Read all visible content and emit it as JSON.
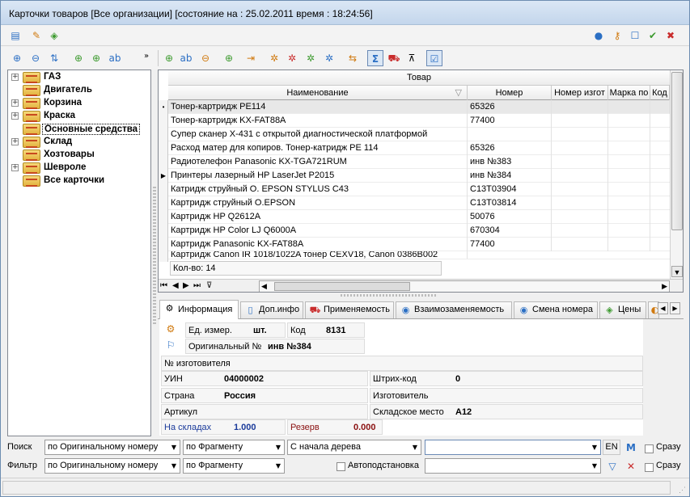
{
  "window": {
    "title": "Карточки товаров  [Все организации] [состояние на : 25.02.2011  время : 18:24:56]"
  },
  "toolbar_top": {
    "left_icons": [
      "report-icon",
      "edit-icon",
      "tag-icon"
    ],
    "right_icons": [
      "help-icon",
      "key-icon",
      "maximize-icon",
      "ok-icon",
      "close-icon"
    ]
  },
  "toolbar_tree": {
    "icons": [
      "zoom-in-icon",
      "zoom-out-icon",
      "sort-az-icon",
      "add-icon",
      "add-copy-icon",
      "rename-icon",
      "more-icon"
    ]
  },
  "toolbar_grid": {
    "icons": [
      "add-icon",
      "edit-icon",
      "delete-icon",
      "add-copy-icon",
      "move-icon",
      "settings-icon",
      "settings-remove-icon",
      "settings-green-icon",
      "settings-blue-icon",
      "group-icon",
      "sum-icon",
      "truck-icon",
      "clear-filter-icon",
      "checklist-icon"
    ]
  },
  "tree": [
    {
      "label": "ГАЗ",
      "expandable": true
    },
    {
      "label": "Двигатель",
      "expandable": false
    },
    {
      "label": "Корзина",
      "expandable": true
    },
    {
      "label": "Краска",
      "expandable": true
    },
    {
      "label": "Основные средства",
      "expandable": false,
      "selected": true
    },
    {
      "label": "Склад",
      "expandable": true
    },
    {
      "label": "Хозтовары",
      "expandable": false
    },
    {
      "label": "Шевроле",
      "expandable": true
    },
    {
      "label": "Все карточки",
      "expandable": false
    }
  ],
  "grid": {
    "group_header": "Товар",
    "columns": [
      "Наименование",
      "Номер",
      "Номер изгот",
      "Марка по",
      "Код"
    ],
    "rows": [
      {
        "name": "Тонер-картридж PE114",
        "number": "65326",
        "indicator": "•"
      },
      {
        "name": "Тонер-картридж KX-FAT88A",
        "number": "77400",
        "indicator": ""
      },
      {
        "name": "Супер сканер X-431 с открытой диагностической платформой",
        "number": "",
        "indicator": ""
      },
      {
        "name": "Расход матер для копиров. Тонер-катридж PE 114",
        "number": "65326",
        "indicator": ""
      },
      {
        "name": "Радиотелефон Panasonic KX-TGA721RUM",
        "number": "инв №383",
        "indicator": ""
      },
      {
        "name": "Принтеры лазерный HP LaserJet P2015",
        "number": "инв №384",
        "indicator": "▶"
      },
      {
        "name": "Катридж струйный O. EPSON STYLUS C43",
        "number": "C13T03904",
        "indicator": ""
      },
      {
        "name": "Картридж струйный O.EPSON",
        "number": "C13T03814",
        "indicator": ""
      },
      {
        "name": "Картридж HP Q2612A",
        "number": "50076",
        "indicator": ""
      },
      {
        "name": "Картридж HP Color LJ Q6000A",
        "number": "670304",
        "indicator": ""
      },
      {
        "name": "Картридж Panasonic KX-FAT88A",
        "number": "77400",
        "indicator": ""
      },
      {
        "name": "Картридж Canon IR 1018/1022A тонер CEXV18, Canon 0386B002",
        "number": "",
        "indicator": ""
      }
    ],
    "count_label": "Кол-во: 14",
    "nav": [
      "⏮",
      "◀",
      "▶",
      "⏭"
    ]
  },
  "tabs": [
    {
      "label": "Информация",
      "icon": "gear-icon",
      "active": true
    },
    {
      "label": "Доп.инфо",
      "icon": "document-icon",
      "active": false
    },
    {
      "label": "Применяемость",
      "icon": "truck-icon",
      "active": false
    },
    {
      "label": "Взаимозаменяемость",
      "icon": "swap-icon",
      "active": false
    },
    {
      "label": "Смена номера",
      "icon": "swap-icon",
      "active": false
    },
    {
      "label": "Цены",
      "icon": "tag-icon",
      "active": false
    }
  ],
  "info": {
    "unit_label": "Ед. измер.",
    "unit_value": "шт.",
    "code_label": "Код",
    "code_value": "8131",
    "original_label": "Оригинальный №",
    "original_value": "инв №384",
    "mfr_number_label": "№ изготовителя",
    "uin_label": "УИН",
    "uin_value": "04000002",
    "barcode_label": "Штрих-код",
    "barcode_value": "0",
    "country_label": "Страна",
    "country_value": "Россия",
    "maker_label": "Изготовитель",
    "article_label": "Артикул",
    "location_label": "Складское место",
    "location_value": "A12",
    "stock_label": "На складах",
    "stock_value": "1.000",
    "reserve_label": "Резерв",
    "reserve_value": "0.000",
    "colors": {
      "stock": "#1a3a9a",
      "reserve": "#8a1010"
    }
  },
  "search": {
    "label": "Поиск",
    "by": "по Оригинальному номеру",
    "mode": "по Фрагменту",
    "scope": "С начала дерева",
    "text": "",
    "lang": "EN",
    "at_once": "Сразу"
  },
  "filter": {
    "label": "Фильтр",
    "by": "по Оригинальному номеру",
    "mode": "по Фрагменту",
    "autocomplete": "Автоподстановка",
    "text": "",
    "at_once": "Сразу"
  }
}
